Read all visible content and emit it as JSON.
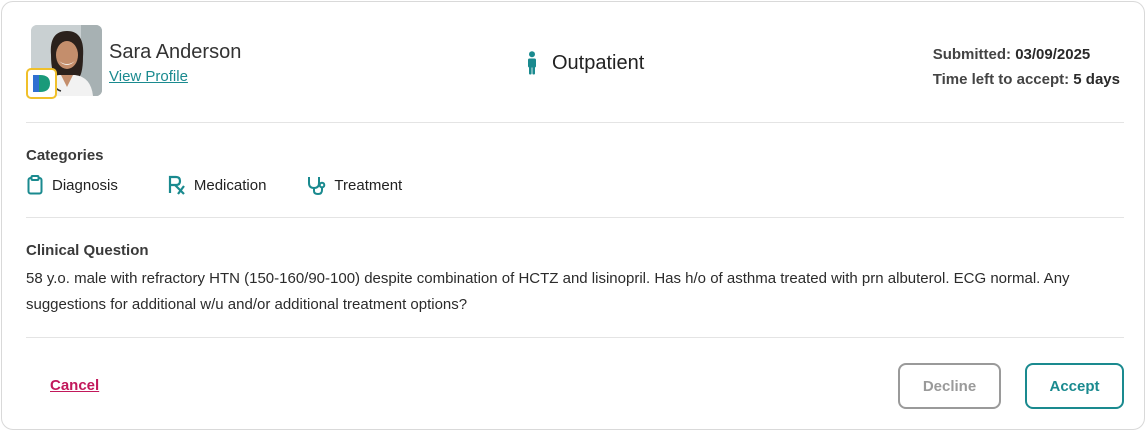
{
  "request": {
    "user": {
      "name": "Sara Anderson",
      "profile_link": "View Profile",
      "avatar": "person-photo",
      "badge": "D-logo-badge"
    },
    "encounter": {
      "icon": "person-standing-icon",
      "label": "Outpatient"
    },
    "meta": {
      "submitted_label": "Submitted:",
      "submitted_value": "03/09/2025",
      "time_left_label": "Time left to accept:",
      "time_left_value": "5 days"
    },
    "categories": {
      "title": "Categories",
      "items": [
        {
          "label": "Diagnosis",
          "icon": "clipboard-icon"
        },
        {
          "label": "Medication",
          "icon": "rx-icon"
        },
        {
          "label": "Treatment",
          "icon": "stethoscope-icon"
        }
      ]
    },
    "clinical_question": {
      "title": "Clinical Question",
      "text": "58 y.o. male with refractory HTN (150-160/90-100) despite combination of HCTZ and lisinopril. Has h/o of asthma treated with prn albuterol. ECG normal. Any suggestions for additional w/u and/or additional treatment options?"
    },
    "actions": {
      "cancel": "Cancel",
      "decline": "Decline",
      "accept": "Accept"
    },
    "colors": {
      "accent": "#1a8a8f",
      "cancel": "#c2185b",
      "badge_border": "#f0c02a",
      "muted": "#9a9a9a"
    }
  }
}
